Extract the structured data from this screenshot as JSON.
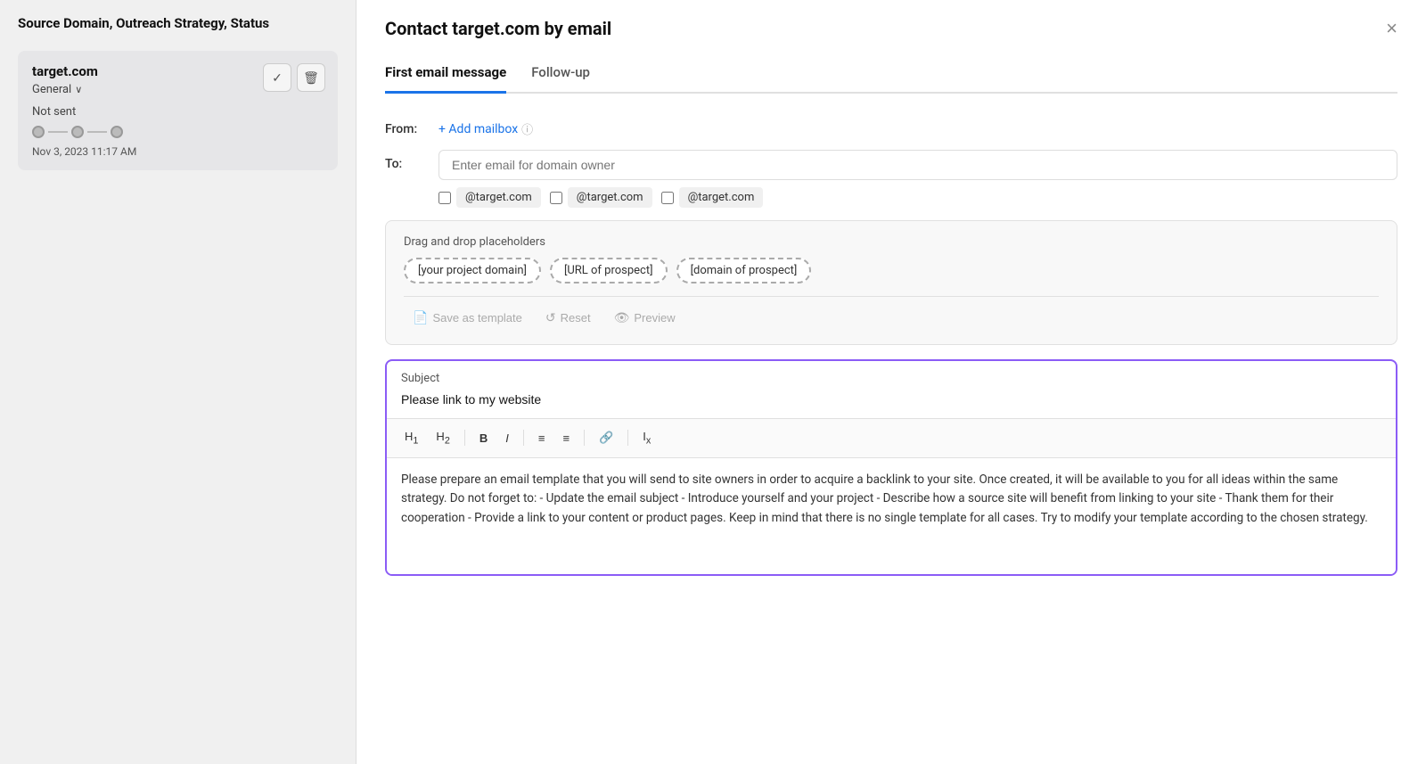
{
  "sidebar": {
    "header": "Source Domain, Outreach Strategy, Status",
    "card": {
      "domain": "target.com",
      "type": "General",
      "status": "Not sent",
      "date": "Nov 3, 2023 11:17 AM",
      "actions": {
        "check": "✓",
        "trash": "🗑"
      }
    }
  },
  "modal": {
    "title": "Contact target.com by email",
    "close_label": "×",
    "tabs": [
      {
        "label": "First email message",
        "active": true
      },
      {
        "label": "Follow-up",
        "active": false
      }
    ],
    "from_label": "From:",
    "add_mailbox_label": "+ Add mailbox",
    "info_icon": "ⓘ",
    "to_label": "To:",
    "to_placeholder": "Enter email for domain owner",
    "email_suggestions": [
      {
        "email": "@target.com"
      },
      {
        "email": "@target.com"
      },
      {
        "email": "@target.com"
      }
    ],
    "dnd": {
      "label": "Drag and drop placeholders",
      "chips": [
        "[your project domain]",
        "[URL of prospect]",
        "[domain of prospect]"
      ]
    },
    "toolbar": {
      "save_template_label": "Save as template",
      "reset_label": "Reset",
      "preview_label": "Preview"
    },
    "subject": {
      "section_label": "Subject",
      "value": "Please link to my website"
    },
    "editor": {
      "tools": [
        "H₁",
        "H₂",
        "B",
        "I",
        "≡",
        "≡",
        "🔗",
        "Iₓ"
      ],
      "content": "Please prepare an email template that you will send to site owners in order to acquire a backlink to your site. Once created, it will be available to you for all ideas within the same strategy. Do not forget to: - Update the email subject - Introduce yourself and your project - Describe how a source site will benefit from linking to your site - Thank them for their cooperation - Provide a link to your content or product pages. Keep in mind that there is no single template for all cases. Try to modify your template according to the chosen strategy."
    }
  }
}
